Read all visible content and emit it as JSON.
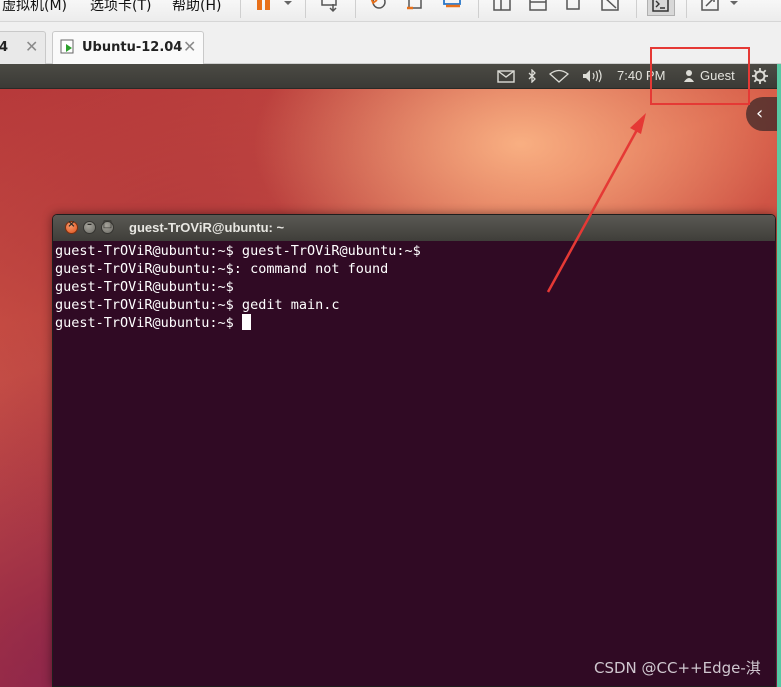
{
  "menu": {
    "items": [
      "虚拟机(M)",
      "选项卡(T)",
      "帮助(H)"
    ]
  },
  "toolbar": {
    "icons": [
      "pause-icon",
      "dropdown-icon",
      "send-keys-icon",
      "snapshot-icon",
      "revert-snapshot-icon",
      "snapshot-manager-icon",
      "fullscreen-icon",
      "unity-icon",
      "console-view-icon",
      "stretch-icon",
      "terminal-view-icon",
      "stretch-dropdown-icon"
    ]
  },
  "tabs": [
    {
      "label": "4",
      "active": false
    },
    {
      "label": "Ubuntu-12.04",
      "active": true
    }
  ],
  "panel": {
    "time": "7:40 PM",
    "user": "Guest",
    "icons": [
      "mail-icon",
      "bluetooth-icon",
      "wifi-icon",
      "volume-icon",
      "user-icon",
      "gear-icon"
    ]
  },
  "terminal": {
    "title": "guest-TrOViR@ubuntu: ~",
    "lines": [
      "guest-TrOViR@ubuntu:~$ guest-TrOViR@ubuntu:~$",
      "guest-TrOViR@ubuntu:~$: command not found",
      "guest-TrOViR@ubuntu:~$",
      "guest-TrOViR@ubuntu:~$ gedit main.c",
      "guest-TrOViR@ubuntu:~$ "
    ]
  },
  "annotation": {
    "color": "#e53935"
  },
  "watermark": "CSDN @CC++Edge-淇",
  "colors": {
    "terminal_bg": "#300a24",
    "panel_bg": "#3c3b37",
    "accent_border": "#57c9a3"
  }
}
